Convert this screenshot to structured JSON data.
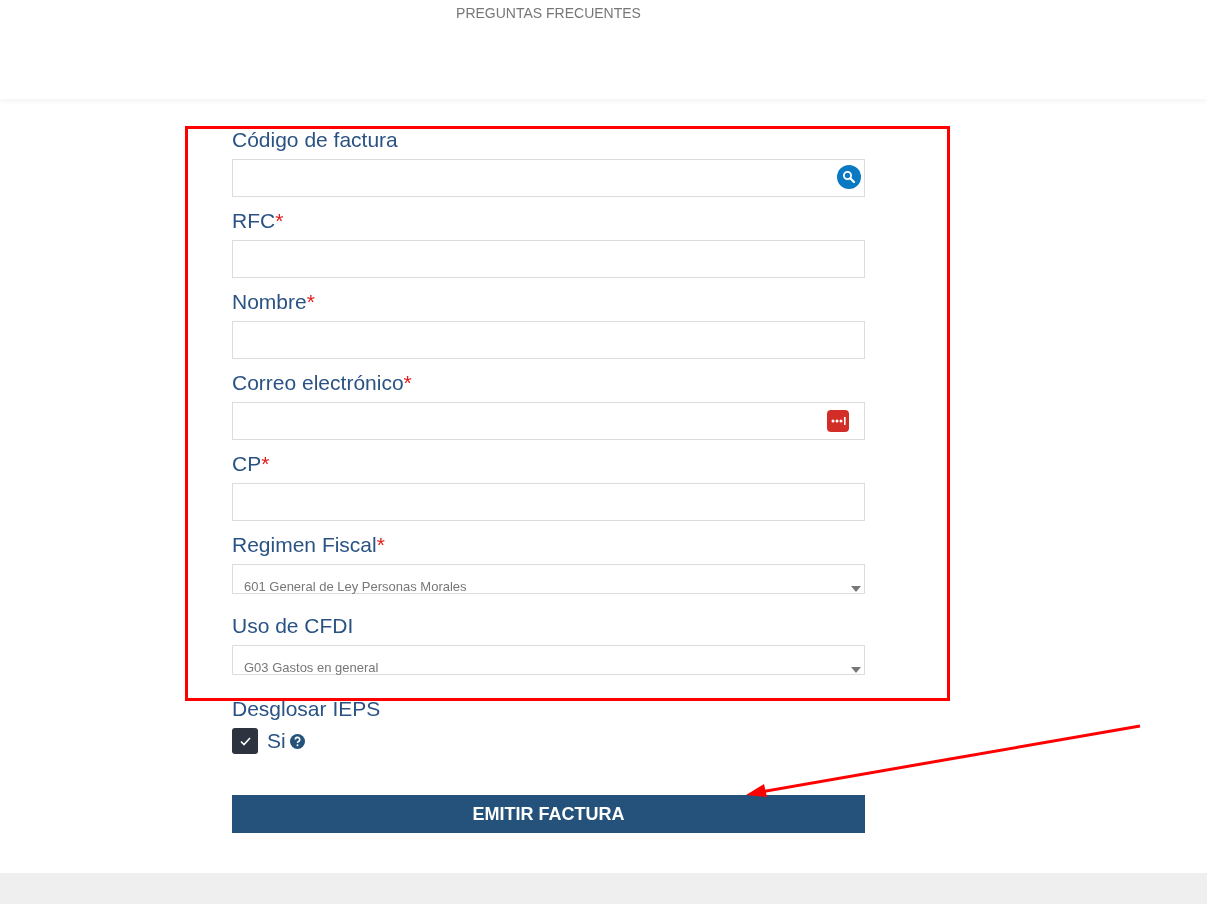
{
  "header": {
    "nav_link": "PREGUNTAS FRECUENTES"
  },
  "fields": [
    {
      "label": "Código de factura",
      "kind": "search"
    },
    {
      "label": "RFC",
      "required_mark": "*",
      "kind": "text"
    },
    {
      "label": "Nombre",
      "required_mark": "*",
      "kind": "text"
    },
    {
      "label": "Correo electrónico",
      "required_mark": "*",
      "kind": "email"
    },
    {
      "label": "CP",
      "required_mark": "*",
      "kind": "text"
    },
    {
      "label": "Regimen Fiscal",
      "required_mark": "*",
      "kind": "select",
      "value": "601 General de Ley Personas Morales"
    },
    {
      "label": "Uso de CFDI",
      "kind": "select",
      "value": "G03 Gastos en general"
    }
  ],
  "ieps": {
    "label": "Desglosar IEPS",
    "option": "Si",
    "checked": true
  },
  "submit": "EMITIR FACTURA"
}
